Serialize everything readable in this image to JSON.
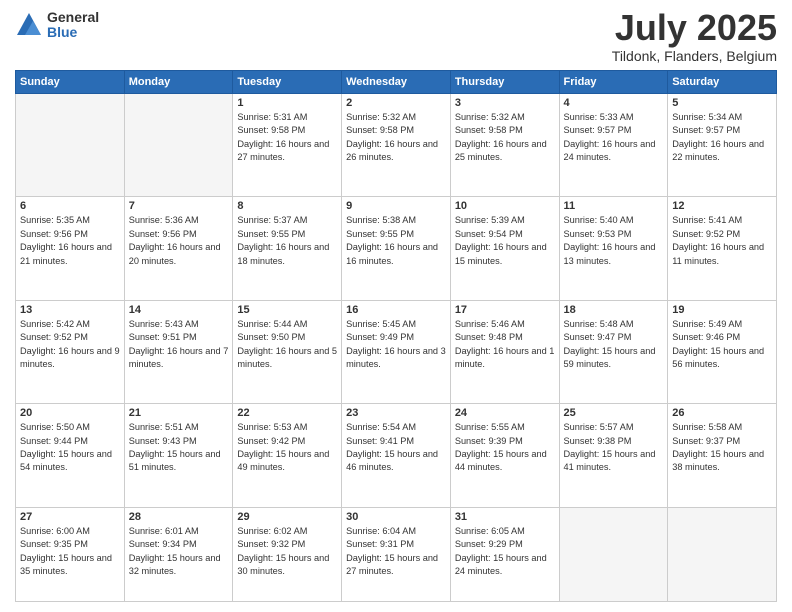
{
  "header": {
    "logo_general": "General",
    "logo_blue": "Blue",
    "title": "July 2025",
    "location": "Tildonk, Flanders, Belgium"
  },
  "days_of_week": [
    "Sunday",
    "Monday",
    "Tuesday",
    "Wednesday",
    "Thursday",
    "Friday",
    "Saturday"
  ],
  "weeks": [
    [
      {
        "day": "",
        "info": ""
      },
      {
        "day": "",
        "info": ""
      },
      {
        "day": "1",
        "info": "Sunrise: 5:31 AM\nSunset: 9:58 PM\nDaylight: 16 hours and 27 minutes."
      },
      {
        "day": "2",
        "info": "Sunrise: 5:32 AM\nSunset: 9:58 PM\nDaylight: 16 hours and 26 minutes."
      },
      {
        "day": "3",
        "info": "Sunrise: 5:32 AM\nSunset: 9:58 PM\nDaylight: 16 hours and 25 minutes."
      },
      {
        "day": "4",
        "info": "Sunrise: 5:33 AM\nSunset: 9:57 PM\nDaylight: 16 hours and 24 minutes."
      },
      {
        "day": "5",
        "info": "Sunrise: 5:34 AM\nSunset: 9:57 PM\nDaylight: 16 hours and 22 minutes."
      }
    ],
    [
      {
        "day": "6",
        "info": "Sunrise: 5:35 AM\nSunset: 9:56 PM\nDaylight: 16 hours and 21 minutes."
      },
      {
        "day": "7",
        "info": "Sunrise: 5:36 AM\nSunset: 9:56 PM\nDaylight: 16 hours and 20 minutes."
      },
      {
        "day": "8",
        "info": "Sunrise: 5:37 AM\nSunset: 9:55 PM\nDaylight: 16 hours and 18 minutes."
      },
      {
        "day": "9",
        "info": "Sunrise: 5:38 AM\nSunset: 9:55 PM\nDaylight: 16 hours and 16 minutes."
      },
      {
        "day": "10",
        "info": "Sunrise: 5:39 AM\nSunset: 9:54 PM\nDaylight: 16 hours and 15 minutes."
      },
      {
        "day": "11",
        "info": "Sunrise: 5:40 AM\nSunset: 9:53 PM\nDaylight: 16 hours and 13 minutes."
      },
      {
        "day": "12",
        "info": "Sunrise: 5:41 AM\nSunset: 9:52 PM\nDaylight: 16 hours and 11 minutes."
      }
    ],
    [
      {
        "day": "13",
        "info": "Sunrise: 5:42 AM\nSunset: 9:52 PM\nDaylight: 16 hours and 9 minutes."
      },
      {
        "day": "14",
        "info": "Sunrise: 5:43 AM\nSunset: 9:51 PM\nDaylight: 16 hours and 7 minutes."
      },
      {
        "day": "15",
        "info": "Sunrise: 5:44 AM\nSunset: 9:50 PM\nDaylight: 16 hours and 5 minutes."
      },
      {
        "day": "16",
        "info": "Sunrise: 5:45 AM\nSunset: 9:49 PM\nDaylight: 16 hours and 3 minutes."
      },
      {
        "day": "17",
        "info": "Sunrise: 5:46 AM\nSunset: 9:48 PM\nDaylight: 16 hours and 1 minute."
      },
      {
        "day": "18",
        "info": "Sunrise: 5:48 AM\nSunset: 9:47 PM\nDaylight: 15 hours and 59 minutes."
      },
      {
        "day": "19",
        "info": "Sunrise: 5:49 AM\nSunset: 9:46 PM\nDaylight: 15 hours and 56 minutes."
      }
    ],
    [
      {
        "day": "20",
        "info": "Sunrise: 5:50 AM\nSunset: 9:44 PM\nDaylight: 15 hours and 54 minutes."
      },
      {
        "day": "21",
        "info": "Sunrise: 5:51 AM\nSunset: 9:43 PM\nDaylight: 15 hours and 51 minutes."
      },
      {
        "day": "22",
        "info": "Sunrise: 5:53 AM\nSunset: 9:42 PM\nDaylight: 15 hours and 49 minutes."
      },
      {
        "day": "23",
        "info": "Sunrise: 5:54 AM\nSunset: 9:41 PM\nDaylight: 15 hours and 46 minutes."
      },
      {
        "day": "24",
        "info": "Sunrise: 5:55 AM\nSunset: 9:39 PM\nDaylight: 15 hours and 44 minutes."
      },
      {
        "day": "25",
        "info": "Sunrise: 5:57 AM\nSunset: 9:38 PM\nDaylight: 15 hours and 41 minutes."
      },
      {
        "day": "26",
        "info": "Sunrise: 5:58 AM\nSunset: 9:37 PM\nDaylight: 15 hours and 38 minutes."
      }
    ],
    [
      {
        "day": "27",
        "info": "Sunrise: 6:00 AM\nSunset: 9:35 PM\nDaylight: 15 hours and 35 minutes."
      },
      {
        "day": "28",
        "info": "Sunrise: 6:01 AM\nSunset: 9:34 PM\nDaylight: 15 hours and 32 minutes."
      },
      {
        "day": "29",
        "info": "Sunrise: 6:02 AM\nSunset: 9:32 PM\nDaylight: 15 hours and 30 minutes."
      },
      {
        "day": "30",
        "info": "Sunrise: 6:04 AM\nSunset: 9:31 PM\nDaylight: 15 hours and 27 minutes."
      },
      {
        "day": "31",
        "info": "Sunrise: 6:05 AM\nSunset: 9:29 PM\nDaylight: 15 hours and 24 minutes."
      },
      {
        "day": "",
        "info": ""
      },
      {
        "day": "",
        "info": ""
      }
    ]
  ]
}
